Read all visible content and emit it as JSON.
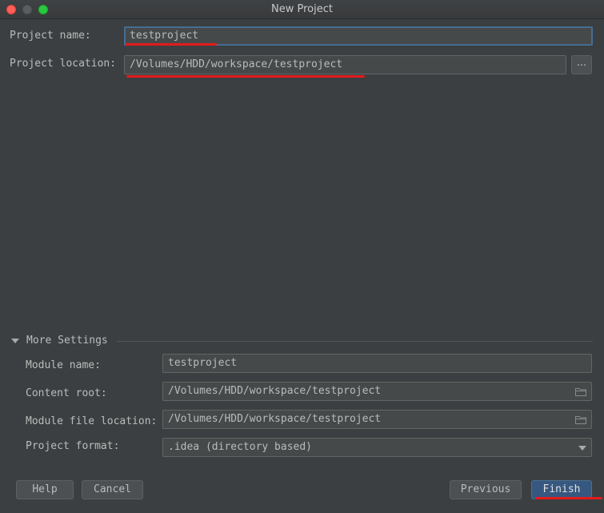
{
  "window": {
    "title": "New Project"
  },
  "project": {
    "name_label": "Project name:",
    "name_value": "testproject",
    "location_label": "Project location:",
    "location_value": "/Volumes/HDD/workspace/testproject",
    "browse_label": "..."
  },
  "more_settings": {
    "title": "More Settings",
    "expanded": true,
    "module_name_label": "Module name:",
    "module_name_value": "testproject",
    "content_root_label": "Content root:",
    "content_root_value": "/Volumes/HDD/workspace/testproject",
    "module_file_label": "Module file location:",
    "module_file_value": "/Volumes/HDD/workspace/testproject",
    "format_label": "Project format:",
    "format_value": ".idea (directory based)"
  },
  "buttons": {
    "help": "Help",
    "cancel": "Cancel",
    "previous": "Previous",
    "finish": "Finish"
  },
  "icons": {
    "folder": "folder-icon",
    "dropdown": "chevron-down-icon",
    "collapse": "triangle-down-icon"
  },
  "colors": {
    "background": "#3c3f41",
    "field_bg": "#45494a",
    "focus_border": "#466d94",
    "default_button": "#365880",
    "annotation_red": "#e31b1b"
  }
}
